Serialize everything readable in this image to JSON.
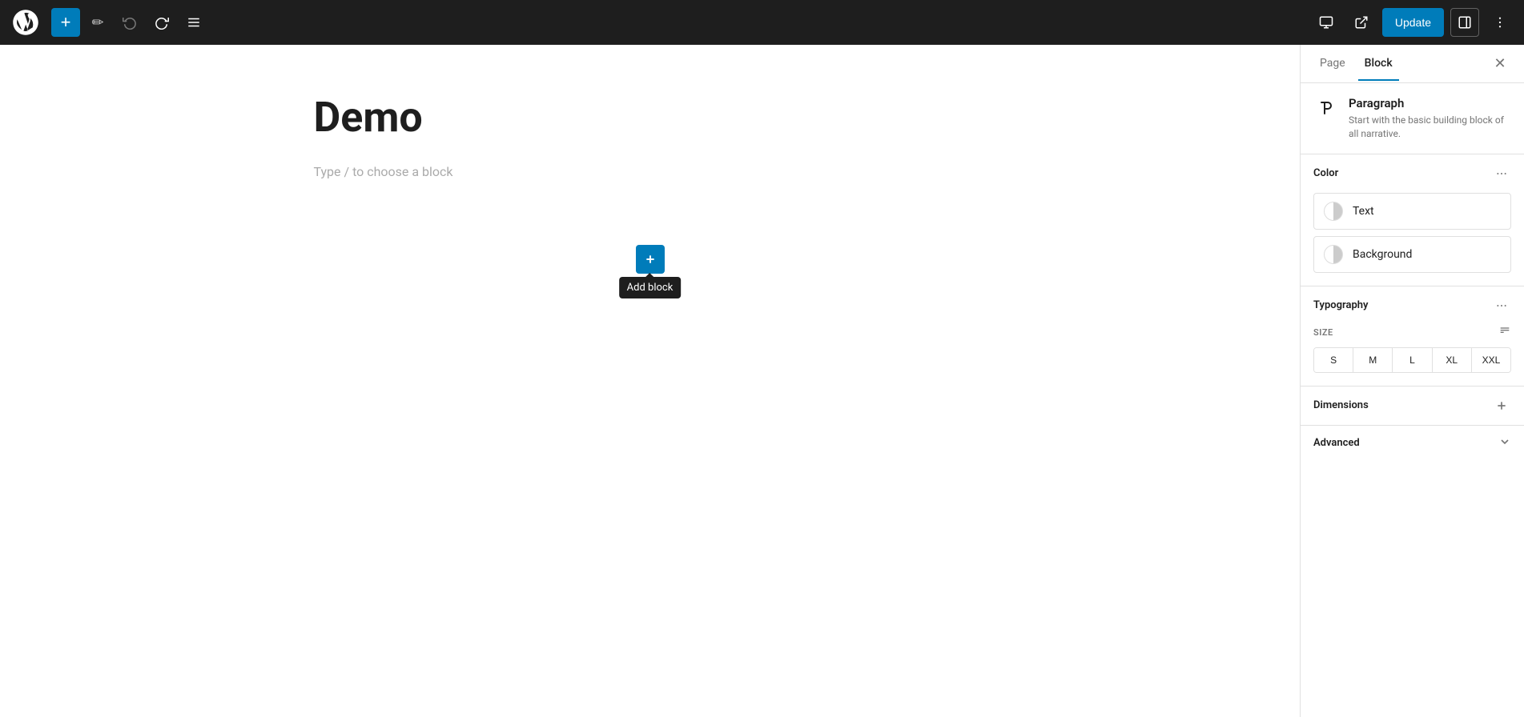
{
  "toolbar": {
    "add_label": "+",
    "undo_label": "↩",
    "redo_label": "↪",
    "list_label": "≡",
    "update_label": "Update",
    "view_label": "⊡",
    "external_label": "↗",
    "more_label": "⋮",
    "sidebar_toggle_label": "▣"
  },
  "editor": {
    "post_title": "Demo",
    "block_placeholder": "Type / to choose a block",
    "add_block_tooltip": "Add block"
  },
  "sidebar": {
    "tab_page_label": "Page",
    "tab_block_label": "Block",
    "active_tab": "Block",
    "close_label": "✕",
    "block_info": {
      "title": "Paragraph",
      "description": "Start with the basic building block of all narrative."
    },
    "color_section": {
      "title": "Color",
      "more_label": "⋮",
      "options": [
        {
          "label": "Text"
        },
        {
          "label": "Background"
        }
      ]
    },
    "typography_section": {
      "title": "Typography",
      "more_label": "⋮",
      "size_label": "SIZE",
      "size_options": [
        "S",
        "M",
        "L",
        "XL",
        "XXL"
      ]
    },
    "dimensions_section": {
      "title": "Dimensions",
      "add_label": "+"
    },
    "advanced_section": {
      "title": "Advanced",
      "toggle_label": "▾"
    }
  },
  "colors": {
    "brand_blue": "#007cba",
    "dark_bg": "#1e1e1e",
    "border": "#e0e0e0",
    "muted": "#757575"
  }
}
